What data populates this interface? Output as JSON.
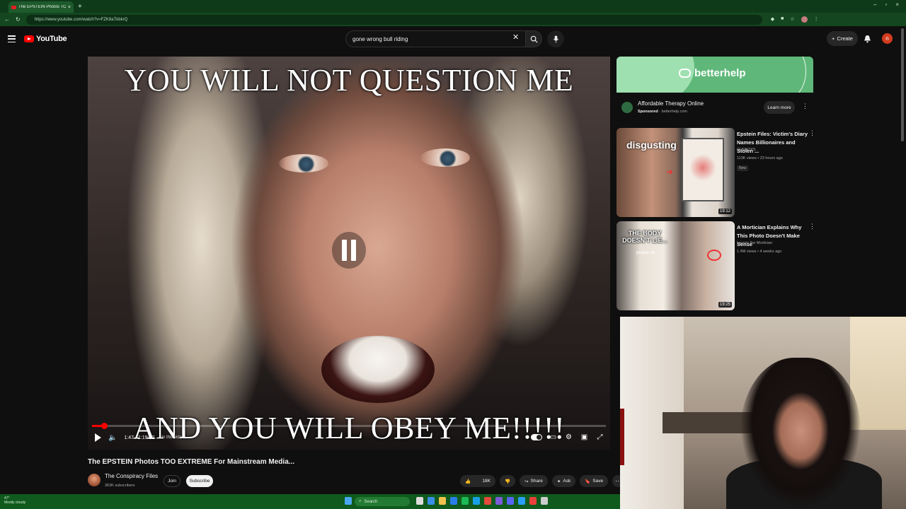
{
  "browser": {
    "tab_title": "The EPSTEIN Photos TOO E",
    "url": "https://www.youtube.com/watch?v=FZK8aTkbkrQ"
  },
  "header": {
    "logo_text": "YouTube",
    "search_value": "gone wrong bull riding",
    "create_label": "Create",
    "avatar_letter": "n"
  },
  "player": {
    "caption_top": "YOU WILL NOT QUESTION ME",
    "caption_bottom": "AND YOU WILL OBEY ME!!!!!",
    "time": "1:47 / 1:19:12",
    "chapter": "In this video",
    "progress_fraction": 0.023
  },
  "video": {
    "title": "The EPSTEIN Photos TOO EXTREME For Mainstream Media...",
    "channel": "The Conspiracy Files",
    "subscribers": "363K subscribers",
    "join_label": "Join",
    "subscribe_label": "Subscribe",
    "likes": "18K",
    "share_label": "Share",
    "ask_label": "Ask",
    "save_label": "Save"
  },
  "sidebar": {
    "ad": {
      "brand": "betterhelp",
      "title": "Affordable Therapy Online",
      "sponsored": "Sponsored",
      "domain": "betterhelp.com",
      "cta": "Learn more"
    },
    "recommendations": [
      {
        "title": "Epstein Files: Victim's Diary Names Billionaires and Stolen ...",
        "channel": "CUFBOYS",
        "meta": "113K views • 23 hours ago",
        "badge": "New",
        "duration": "19:12",
        "thumb_text": "disgusting"
      },
      {
        "title": "A Mortician Explains Why This Photo Doesn't Make Sense",
        "channel": "Lauren the Mortician",
        "meta": "1.4M views • 4 weeks ago",
        "duration": "19:25",
        "thumb_text": "THE BODY DOESN'T LIE...",
        "thumb_subtext": "people do"
      }
    ]
  },
  "taskbar": {
    "weather_line1": "47°",
    "weather_line2": "Mostly cloudy",
    "search_placeholder": "Search"
  }
}
